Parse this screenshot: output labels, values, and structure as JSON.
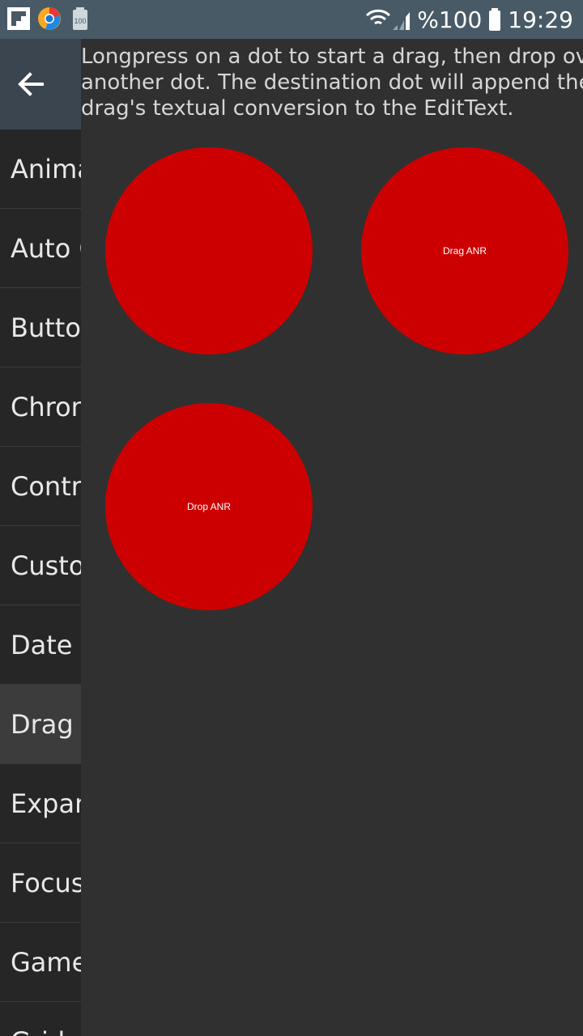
{
  "status_bar": {
    "battery_percent": "%100",
    "time": "19:29",
    "notification_icons": [
      "flipboard-icon",
      "chrome-canary-icon",
      "battery-notification-icon"
    ],
    "battery_notification_label": "100"
  },
  "drawer": {
    "items": [
      {
        "label": "Animation"
      },
      {
        "label": "Auto Complete"
      },
      {
        "label": "Buttons"
      },
      {
        "label": "Chronometer"
      },
      {
        "label": "Controls"
      },
      {
        "label": "Custom"
      },
      {
        "label": "Date Widgets"
      },
      {
        "label": "Drag and Drop"
      },
      {
        "label": "Expandable Lists"
      },
      {
        "label": "Focus"
      },
      {
        "label": "Game Controller"
      },
      {
        "label": "Grid"
      }
    ],
    "active_index": 7
  },
  "content": {
    "instructions": "Longpress on a dot to start a drag, then drop over another dot. The destination dot will append the drag's textual conversion to the EditText.",
    "dots": [
      {
        "label": ""
      },
      {
        "label": "Drag ANR"
      },
      {
        "label": "Drop ANR"
      }
    ]
  },
  "colors": {
    "dot": "#cc0000",
    "status_bar": "#485a66",
    "background": "#303030"
  }
}
